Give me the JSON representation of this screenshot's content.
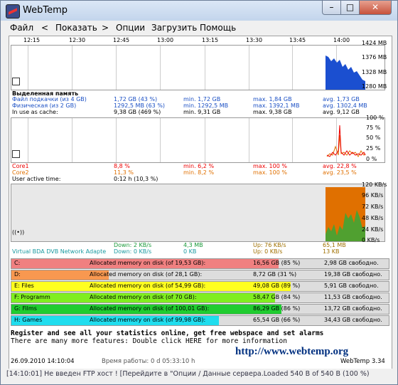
{
  "window": {
    "title": "WebTemp",
    "min": "–",
    "max": "□",
    "close": "✕"
  },
  "menu": [
    "Файл",
    "<",
    "Показать",
    ">",
    "Опции",
    "Загрузить",
    "Помощь"
  ],
  "time_ticks": [
    "12:15",
    "12:30",
    "12:45",
    "13:00",
    "13:15",
    "13:30",
    "13:45",
    "14:00"
  ],
  "memory": {
    "y_ticks": [
      "1424 MB",
      "1376 MB",
      "1328 MB",
      "1280 MB"
    ],
    "header": "Выделенная память",
    "rows": [
      {
        "label": "Файл подкачки (из 4 GB)",
        "cur": "1,72 GB (43 %)",
        "min": "min. 1,72 GB",
        "max": "max. 1,84 GB",
        "avg": "avg. 1,73 GB",
        "color": "#1a4fc4"
      },
      {
        "label": "Физическая (из 2 GB)",
        "cur": "1292,5 MB (63 %)",
        "min": "min. 1292,5 MB",
        "max": "max. 1392,1 MB",
        "avg": "avg. 1302,4 MB",
        "color": "#1a4fc4"
      },
      {
        "label": "In use as cache:",
        "cur": "9,38 GB (469 %)",
        "min": "min. 9,31 GB",
        "max": "max. 9,38 GB",
        "avg": "avg. 9,12 GB",
        "color": "#000000"
      }
    ]
  },
  "cpu": {
    "y_ticks": [
      "100 %",
      "75 %",
      "50 %",
      "25 %",
      "0 %"
    ],
    "rows": [
      {
        "label": "Core1",
        "cur": "8,8 %",
        "min": "min. 6,2 %",
        "max": "max. 100 %",
        "avg": "avg. 22,8 %",
        "color": "#ee0000"
      },
      {
        "label": "Core2",
        "cur": "11,3 %",
        "min": "min. 8,2 %",
        "max": "max. 100 %",
        "avg": "avg. 23,5 %",
        "color": "#e07000"
      }
    ],
    "active_label": "User active time:",
    "active_value": "0:12 h (10,3 %)"
  },
  "network": {
    "y_ticks": [
      "120 KB/s",
      "96 KB/s",
      "72 KB/s",
      "48 KB/s",
      "24 KB/s",
      "0 KB/s"
    ],
    "adapter": "Virtual BDA DVB Network Adapte",
    "down_rate": "Down: 2 KB/s",
    "down_rate2": "Down: 0 KB/s",
    "down_total": "4,3 MB",
    "down_total2": "0 KB",
    "up_rate": "Up: 76 KB/s",
    "up_rate2": "Up: 0 KB/s",
    "up_total": "65,1 MB",
    "up_total2": "13 KB"
  },
  "drives": [
    {
      "name": "C:",
      "alloc": "Allocated memory on disk (of 19,53 GB):",
      "used": "16,56 GB (85 %)",
      "free": "2,98 GB свободно.",
      "pct": 85,
      "color": "#f08080"
    },
    {
      "name": "D:",
      "alloc": "Allocated memory on disk (of 28,1 GB):",
      "used": "8,72 GB (31 %)",
      "free": "19,38 GB свободно.",
      "pct": 31,
      "color": "#f89850"
    },
    {
      "name": "E: Files",
      "alloc": "Allocated memory on disk (of 54,99 GB):",
      "used": "49,08 GB (89 %)",
      "free": "5,91 GB свободно.",
      "pct": 89,
      "color": "#ffff20"
    },
    {
      "name": "F: Programm",
      "alloc": "Allocated memory on disk (of 70 GB):",
      "used": "58,47 GB (84 %)",
      "free": "11,53 GB свободно.",
      "pct": 84,
      "color": "#80ee20"
    },
    {
      "name": "G: Films",
      "alloc": "Allocated memory on disk (of 100,01 GB):",
      "used": "86,29 GB (86 %)",
      "free": "13,72 GB свободно.",
      "pct": 86,
      "color": "#20cc30"
    },
    {
      "name": "H: Games",
      "alloc": "Allocated memory on disk (of 99,98 GB):",
      "used": "65,54 GB (66 %)",
      "free": "34,43 GB свободно.",
      "pct": 66,
      "color": "#20ddee"
    }
  ],
  "promo": {
    "line1": "Register and see all your statistics online, get free webspace and set alarms",
    "line2": "There are many more features: Double click HERE for more information",
    "url": "http://www.webtemp.org"
  },
  "status": {
    "datetime": "26.09.2010 14:10:04",
    "uptime": "Время работы: 0 d 05:33:10 h",
    "version": "WebTemp 3.34",
    "bar": "[14:10:01] Не введен FTP хост ! [Перейдите в \"Опции / Данные сервера.Loaded 540 B of 540 B (100 %)"
  },
  "colors": {
    "memory_fill": "#1b4fd0",
    "cpu_core1": "#ee0000",
    "cpu_core2": "#e07000",
    "net_up": "#e07000",
    "net_down": "#50a030"
  }
}
